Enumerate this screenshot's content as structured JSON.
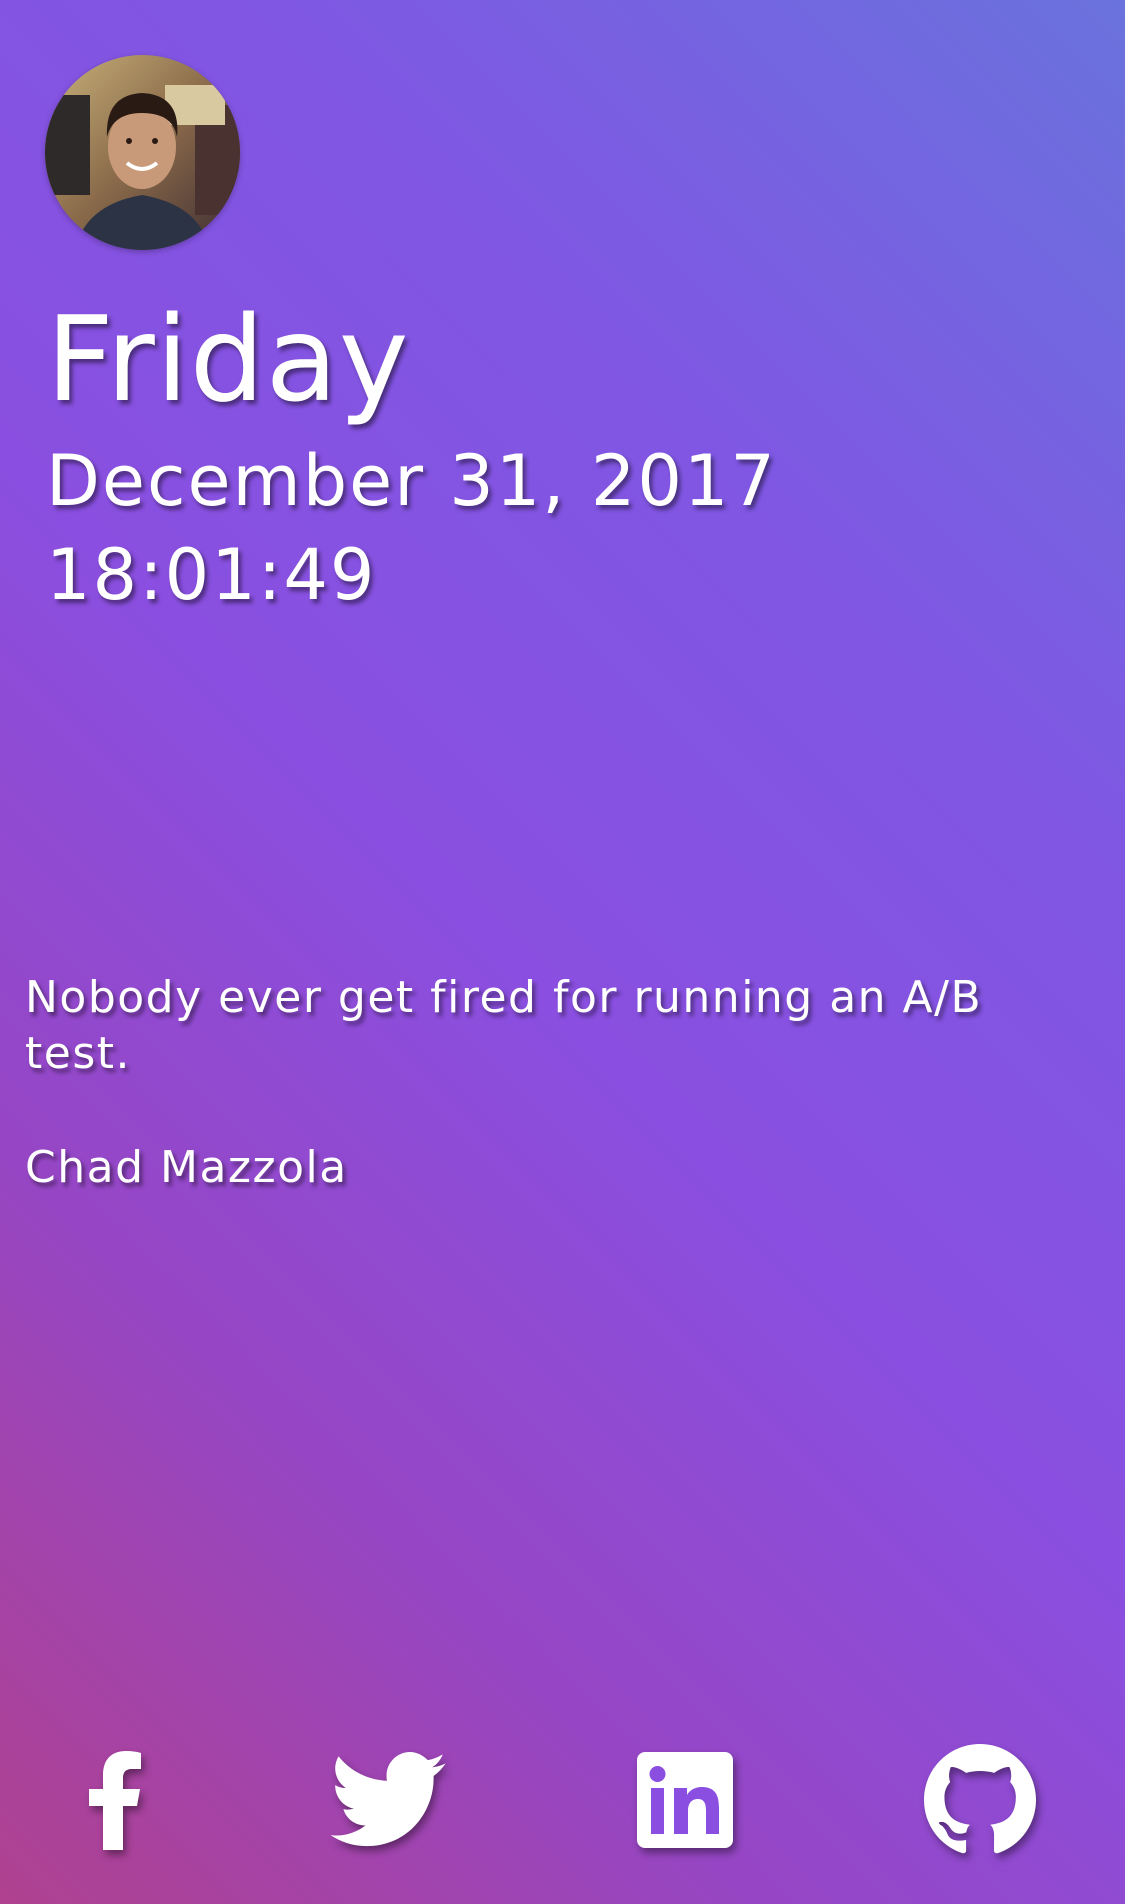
{
  "profile": {
    "avatar_icon": "profile-photo"
  },
  "clock": {
    "day": "Friday",
    "date": "December 31, 2017",
    "time": "18:01:49"
  },
  "quote": {
    "text": "Nobody ever get fired for running an A/B test.",
    "author": "Chad Mazzola"
  },
  "social": [
    {
      "icon": "facebook-icon"
    },
    {
      "icon": "twitter-icon"
    },
    {
      "icon": "linkedin-icon"
    },
    {
      "icon": "github-icon"
    }
  ],
  "colors": {
    "gradient_top_right": "#6a72dd",
    "gradient_middle": "#8a4fe0",
    "gradient_bottom_left": "#b0418f",
    "text": "#ffffff"
  }
}
